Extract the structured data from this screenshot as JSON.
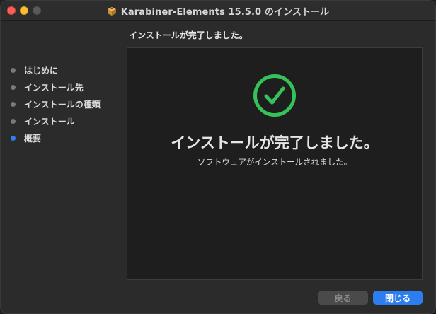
{
  "window": {
    "title": "Karabiner-Elements 15.5.0 のインストール"
  },
  "heading": "インストールが完了しました。",
  "steps": [
    {
      "label": "はじめに",
      "active": false
    },
    {
      "label": "インストール先",
      "active": false
    },
    {
      "label": "インストールの種類",
      "active": false
    },
    {
      "label": "インストール",
      "active": false
    },
    {
      "label": "概要",
      "active": true
    }
  ],
  "content": {
    "title": "インストールが完了しました。",
    "subtitle": "ソフトウェアがインストールされました。",
    "icon": "check-circle-icon",
    "accent": "#35c25a"
  },
  "buttons": {
    "back": "戻る",
    "close": "閉じる"
  },
  "colors": {
    "primary": "#2c7ef0",
    "success": "#35c25a"
  }
}
